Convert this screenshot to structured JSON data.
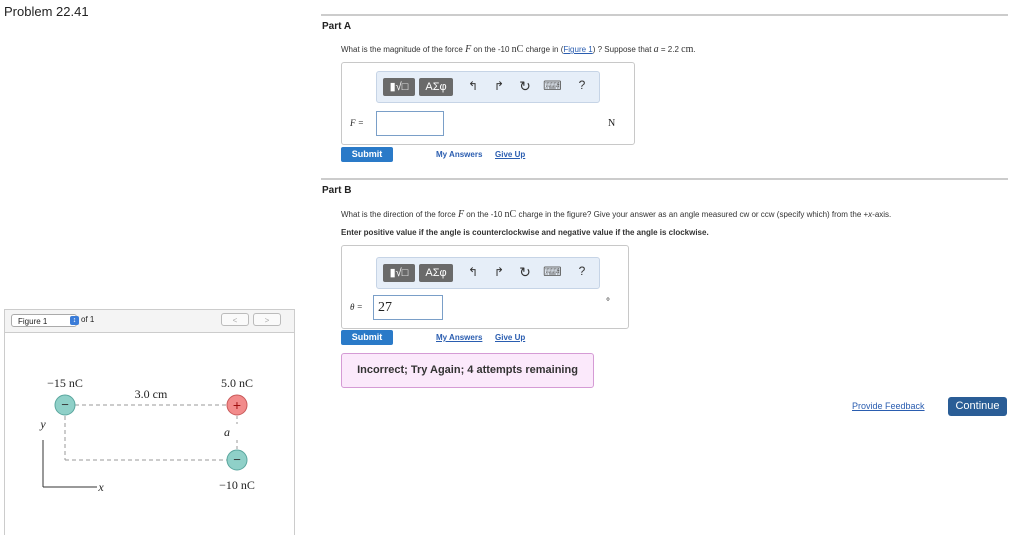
{
  "problem": {
    "title": "Problem 22.41"
  },
  "figure_panel": {
    "select_label": "Figure 1",
    "of_label": "of 1",
    "prev": "<",
    "next": ">",
    "labels": {
      "q1": "−15 nC",
      "q2": "5.0 nC",
      "q3": "−10 nC",
      "distance": "3.0 cm",
      "a": "a",
      "y": "y",
      "x": "x",
      "minus": "−",
      "plus": "+"
    }
  },
  "part_a": {
    "title": "Part A",
    "question_pre": "What is the magnitude of the force ",
    "force_symbol": "F",
    "question_mid": " on the -10 ",
    "unit_nc": "nC",
    "question_mid2": " charge in (",
    "figure_link": "Figure 1",
    "question_post": ") ? Suppose that ",
    "var_a": "a",
    "question_eq": " = 2.2 ",
    "unit_cm": "cm",
    "question_end": ".",
    "input_label": "F =",
    "input_value": "",
    "unit": "N",
    "submit": "Submit",
    "my_answers": "My Answers",
    "give_up": "Give Up"
  },
  "toolbar": {
    "templates": "▮√□",
    "symbols": "AΣφ",
    "undo": "↰",
    "redo": "↱",
    "reset": "↻",
    "keyboard": "⌨",
    "help": "?"
  },
  "part_b": {
    "title": "Part B",
    "question_pre": "What is the direction of the force ",
    "force_symbol": "F",
    "question_mid": " on the -10 ",
    "unit_nc": "nC",
    "question_post": " charge in the figure? Give your answer as an angle measured cw or ccw (specify which) from the +",
    "x_var": "x",
    "question_end": "-axis.",
    "instruction": "Enter positive value if the angle is counterclockwise and negative value if the angle is clockwise.",
    "input_label": "θ =",
    "input_value": "27",
    "unit": "°",
    "submit": "Submit",
    "my_answers": "My Answers",
    "give_up": "Give Up",
    "feedback": "Incorrect; Try Again; 4 attempts remaining"
  },
  "footer": {
    "provide_feedback": "Provide Feedback",
    "continue": "Continue"
  },
  "colors": {
    "negative_charge": "#8fd0c8",
    "positive_charge": "#f28b8b",
    "submit_blue": "#2a7ac8",
    "continue_blue": "#2a5d96"
  }
}
